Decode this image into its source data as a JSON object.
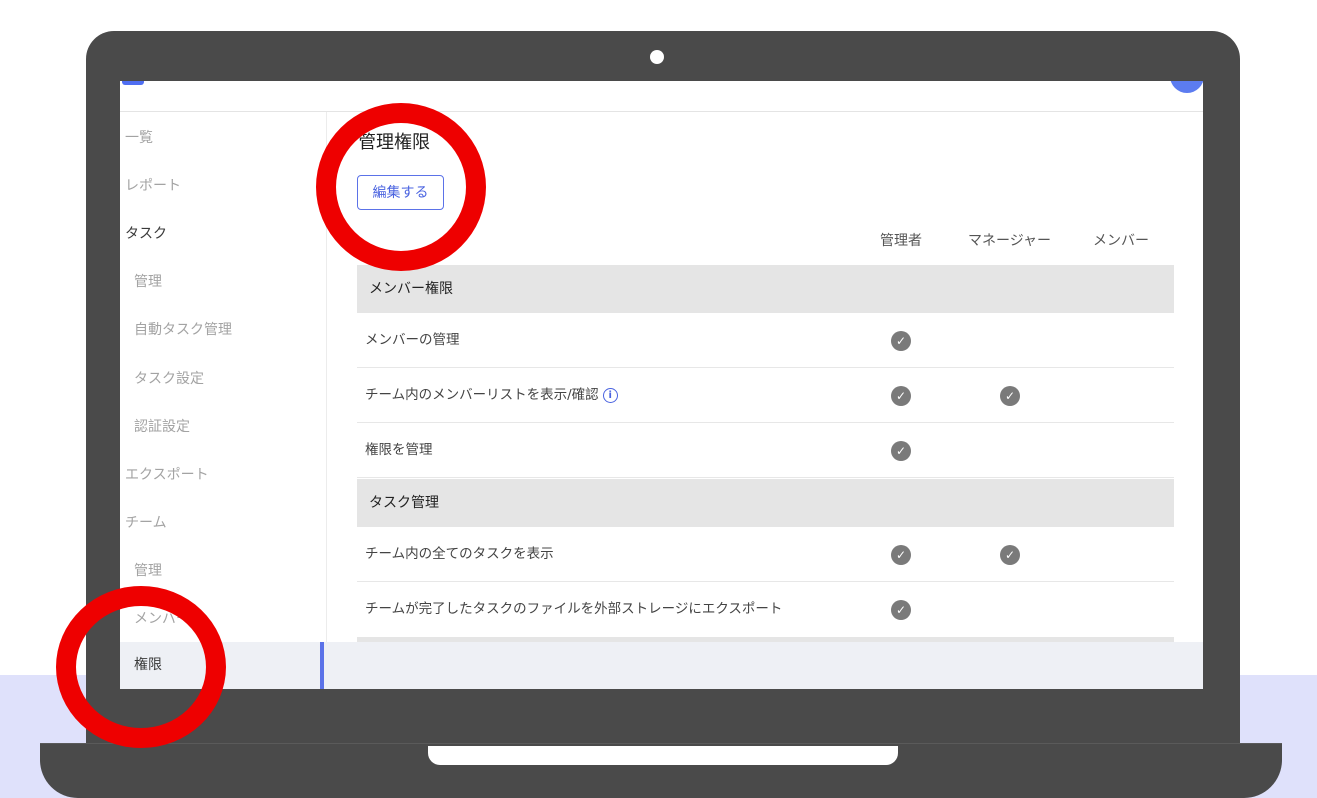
{
  "sidebar": {
    "items": [
      {
        "label": "一覧"
      },
      {
        "label": "レポート"
      },
      {
        "label": "タスク"
      },
      {
        "label": "管理"
      },
      {
        "label": "自動タスク管理"
      },
      {
        "label": "タスク設定"
      },
      {
        "label": "認証設定"
      },
      {
        "label": "エクスポート"
      },
      {
        "label": "チーム"
      },
      {
        "label": "管理"
      },
      {
        "label": "メンバー"
      },
      {
        "label": "権限"
      }
    ]
  },
  "main": {
    "title": "管理権限",
    "edit_button": "編集する",
    "columns": [
      "管理者",
      "マネージャー",
      "メンバー"
    ],
    "sections": [
      {
        "title": "メンバー権限",
        "rows": [
          {
            "label": "メンバーの管理",
            "admin": true,
            "manager": false,
            "member": false
          },
          {
            "label": "チーム内のメンバーリストを表示/確認",
            "admin": true,
            "manager": true,
            "member": false
          },
          {
            "label": "権限を管理",
            "admin": true,
            "manager": false,
            "member": false
          }
        ]
      },
      {
        "title": "タスク管理",
        "rows": [
          {
            "label": "チーム内の全てのタスクを表示",
            "admin": true,
            "manager": true,
            "member": false
          },
          {
            "label": "チームが完了したタスクのファイルを外部ストレージにエクスポート",
            "admin": true,
            "manager": false,
            "member": false
          }
        ]
      }
    ],
    "info_icon_glyph": "i",
    "check_glyph": "✓"
  },
  "colors": {
    "accent": "#5b72e8",
    "highlight_ring": "#ee0000",
    "laptop": "#4a4a4a"
  }
}
